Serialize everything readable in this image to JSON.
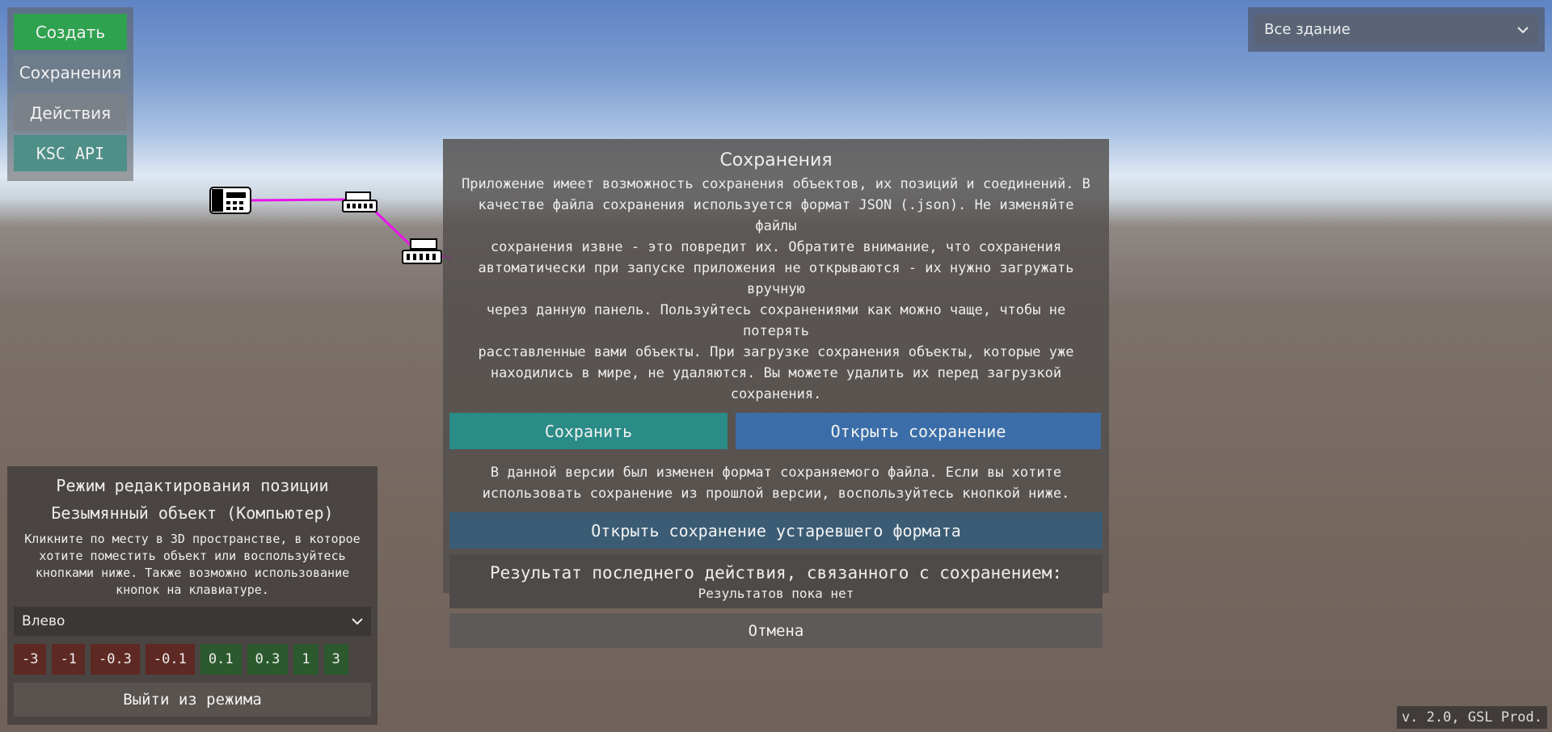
{
  "menu": {
    "create": "Создать",
    "saves": "Сохранения",
    "actions": "Действия",
    "ksc_api": "KSC API"
  },
  "scope_select": {
    "value": "Все здание",
    "icon": "chevron-down-icon"
  },
  "scene": {
    "link_color": "#e815e8",
    "objects": [
      "phone-icon",
      "switch-icon",
      "switch-icon"
    ]
  },
  "save_dialog": {
    "title": "Сохранения",
    "description_lines": [
      "Приложение имеет возможность сохранения объектов, их позиций и соединений. В",
      "качестве файла сохранения используется формат JSON (.json). Не изменяйте файлы",
      "сохранения извне - это повредит их. Обратите внимание, что сохранения",
      "автоматически при запуске приложения не открываются - их нужно загружать вручную",
      "через данную панель. Пользуйтесь сохранениями как можно чаще, чтобы не потерять",
      "расставленные вами объекты. При загрузке сохранения объекты, которые уже",
      "находились в мире, не удаляются. Вы можете удалить их перед загрузкой",
      "сохранения."
    ],
    "save_button": "Сохранить",
    "open_button": "Открыть сохранение",
    "format_note_lines": [
      "В данной версии был изменен формат сохраняемого файла. Если вы хотите",
      "использовать сохранение из прошлой версии, воспользуйтесь кнопкой ниже."
    ],
    "open_old_button": "Открыть сохранение устаревшего формата",
    "result_title": "Результат последнего действия, связанного с сохранением:",
    "result_value": "Результатов пока нет",
    "cancel_button": "Отмена"
  },
  "edit_panel": {
    "title": "Режим редактирования позиции",
    "object_name": "Безымянный объект (Компьютер)",
    "instruction_lines": [
      "Кликните по месту в 3D пространстве, в которое",
      "хотите поместить объект или воспользуйтесь",
      "кнопками ниже. Также возможно использование",
      "кнопок на клавиатуре."
    ],
    "direction": "Влево",
    "steps": [
      "-3",
      "-1",
      "-0.3",
      "-0.1",
      "0.1",
      "0.3",
      "1",
      "3"
    ],
    "exit_button": "Выйти из режима"
  },
  "version": "v. 2.0, GSL Prod."
}
